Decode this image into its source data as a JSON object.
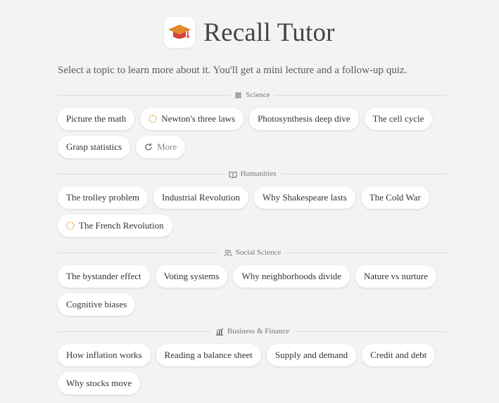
{
  "app": {
    "title": "Recall Tutor"
  },
  "intro": "Select a topic to learn more about it. You'll get a mini lecture and a follow-up quiz.",
  "colors": {
    "background": "#f3f3f3",
    "accent": "#e1892c",
    "logo_red": "#d9413a"
  },
  "sections": [
    {
      "label": "Science",
      "icon": "atom-icon",
      "topics": [
        {
          "label": "Picture the math"
        },
        {
          "label": "Newton's three laws",
          "loading": true
        },
        {
          "label": "Photosynthesis deep dive"
        },
        {
          "label": "The cell cycle"
        },
        {
          "label": "Grasp statistics"
        }
      ],
      "more_label": "More"
    },
    {
      "label": "Humanities",
      "icon": "book-icon",
      "topics": [
        {
          "label": "The trolley problem"
        },
        {
          "label": "Industrial Revolution"
        },
        {
          "label": "Why Shakespeare lasts"
        },
        {
          "label": "The Cold War"
        },
        {
          "label": "The French Revolution",
          "loading": true
        }
      ]
    },
    {
      "label": "Social Science",
      "icon": "users-icon",
      "topics": [
        {
          "label": "The bystander effect"
        },
        {
          "label": "Voting systems"
        },
        {
          "label": "Why neighborhoods divide"
        },
        {
          "label": "Nature vs nurture"
        },
        {
          "label": "Cognitive biases"
        }
      ]
    },
    {
      "label": "Business & Finance",
      "icon": "chart-icon",
      "topics": [
        {
          "label": "How inflation works"
        },
        {
          "label": "Reading a balance sheet"
        },
        {
          "label": "Supply and demand"
        },
        {
          "label": "Credit and debt"
        },
        {
          "label": "Why stocks move"
        }
      ]
    }
  ]
}
